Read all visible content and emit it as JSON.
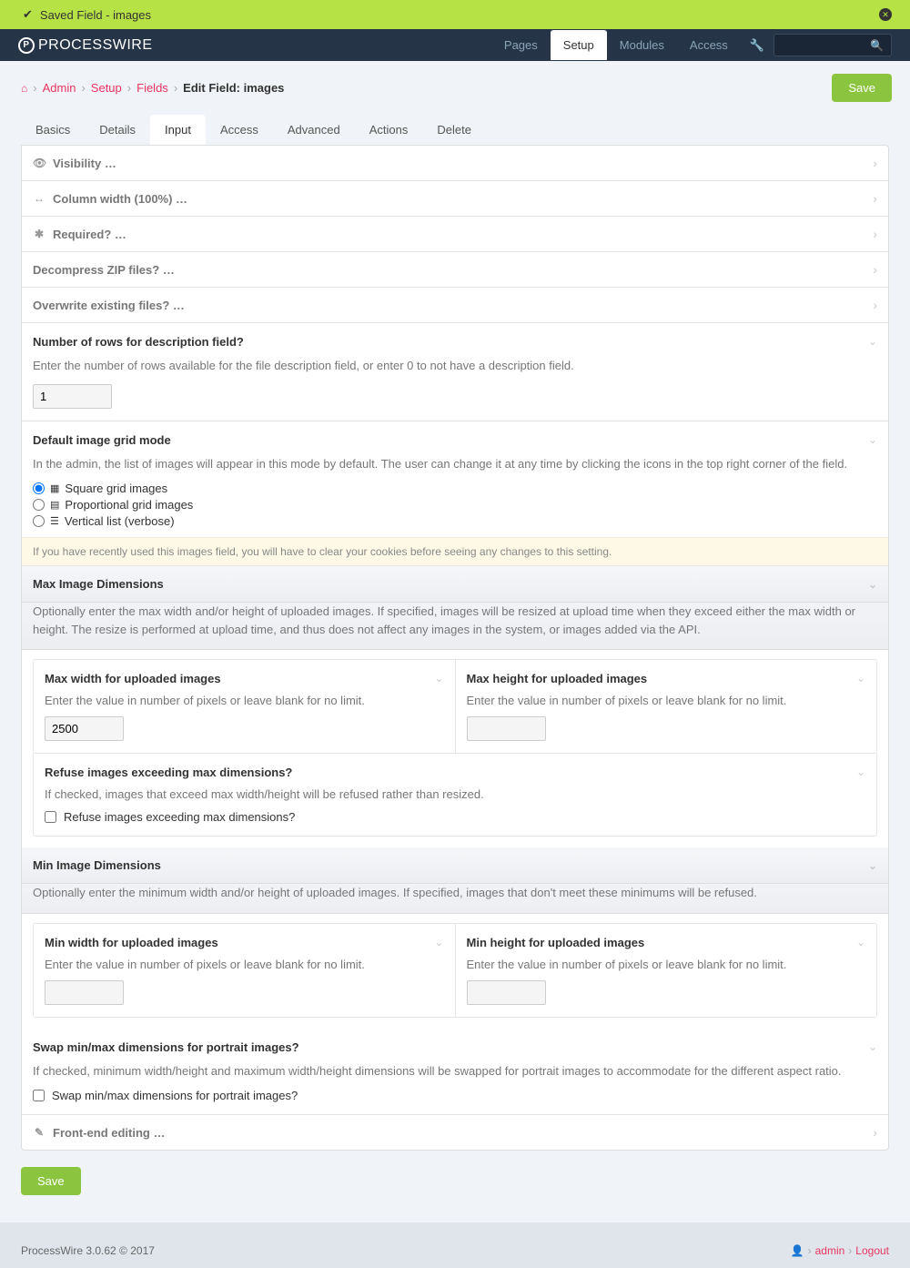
{
  "notice": {
    "text": "Saved Field - images"
  },
  "logo": {
    "text": "PROCESSWIRE"
  },
  "topnav": {
    "pages": "Pages",
    "setup": "Setup",
    "modules": "Modules",
    "access": "Access"
  },
  "breadcrumb": {
    "admin": "Admin",
    "setup": "Setup",
    "fields": "Fields",
    "current": "Edit Field: images"
  },
  "save": "Save",
  "tabs": {
    "basics": "Basics",
    "details": "Details",
    "input": "Input",
    "access": "Access",
    "advanced": "Advanced",
    "actions": "Actions",
    "delete": "Delete"
  },
  "rows": {
    "visibility": "Visibility …",
    "colwidth": "Column width (100%) …",
    "required": "Required? …",
    "zip": "Decompress ZIP files? …",
    "overwrite": "Overwrite existing files? …",
    "frontend": "Front-end editing …"
  },
  "descrows": {
    "title": "Number of rows for description field?",
    "desc": "Enter the number of rows available for the file description field, or enter 0 to not have a description field.",
    "value": "1"
  },
  "gridmode": {
    "title": "Default image grid mode",
    "desc": "In the admin, the list of images will appear in this mode by default. The user can change it at any time by clicking the icons in the top right corner of the field.",
    "opt1": "Square grid images",
    "opt2": "Proportional grid images",
    "opt3": "Vertical list (verbose)",
    "warn": "If you have recently used this images field, you will have to clear your cookies before seeing any changes to this setting."
  },
  "maxdim": {
    "title": "Max Image Dimensions",
    "desc": "Optionally enter the max width and/or height of uploaded images. If specified, images will be resized at upload time when they exceed either the max width or height. The resize is performed at upload time, and thus does not affect any images in the system, or images added via the API.",
    "maxw": {
      "title": "Max width for uploaded images",
      "desc": "Enter the value in number of pixels or leave blank for no limit.",
      "value": "2500"
    },
    "maxh": {
      "title": "Max height for uploaded images",
      "desc": "Enter the value in number of pixels or leave blank for no limit.",
      "value": ""
    },
    "refuse": {
      "title": "Refuse images exceeding max dimensions?",
      "desc": "If checked, images that exceed max width/height will be refused rather than resized.",
      "label": "Refuse images exceeding max dimensions?"
    }
  },
  "mindim": {
    "title": "Min Image Dimensions",
    "desc": "Optionally enter the minimum width and/or height of uploaded images. If specified, images that don't meet these minimums will be refused.",
    "minw": {
      "title": "Min width for uploaded images",
      "desc": "Enter the value in number of pixels or leave blank for no limit.",
      "value": ""
    },
    "minh": {
      "title": "Min height for uploaded images",
      "desc": "Enter the value in number of pixels or leave blank for no limit.",
      "value": ""
    }
  },
  "swap": {
    "title": "Swap min/max dimensions for portrait images?",
    "desc": "If checked, minimum width/height and maximum width/height dimensions will be swapped for portrait images to accommodate for the different aspect ratio.",
    "label": "Swap min/max dimensions for portrait images?"
  },
  "footer": {
    "version": "ProcessWire 3.0.62 © 2017",
    "user": "admin",
    "logout": "Logout"
  }
}
